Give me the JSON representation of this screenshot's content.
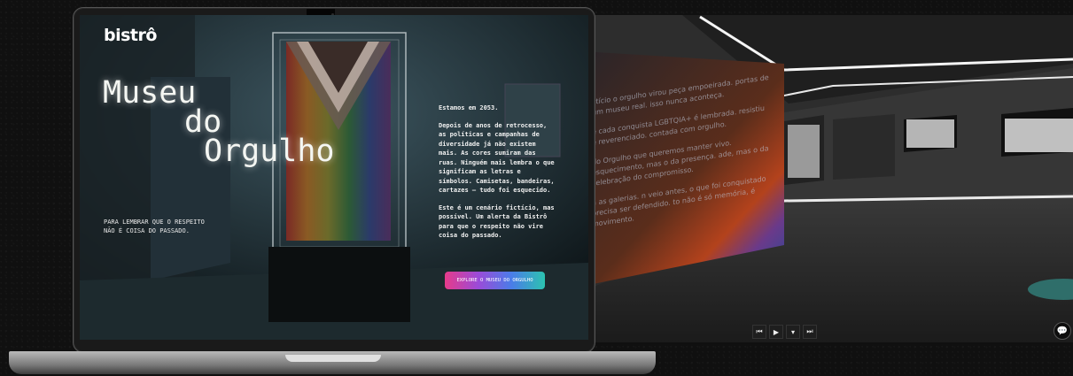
{
  "laptop_site": {
    "brand": "bistrô",
    "title_lines": [
      "Museu",
      "do",
      "Orgulho"
    ],
    "tagline_line1": "PARA LEMBRAR QUE O RESPEITO",
    "tagline_line2": "NÃO É COISA DO PASSADO.",
    "paragraphs": [
      "Estamos em 2053.",
      "Depois de anos de retrocesso, as políticas e campanhas de diversidade já não existem mais. As cores sumiram das ruas. Ninguém mais lembra o que significam as letras e símbolos. Camisetas, bandeiras, cartazes – tudo foi esquecido.",
      "Este é um cenário fictício, mas possível. Um alerta da Bistrô para que o respeito não vire coisa do passado."
    ],
    "cta_label": "EXPLORE O MUSEU DO ORGULHO"
  },
  "gallery": {
    "wall_text": [
      "ctício o orgulho virou peça empoeirada. portas de um museu real. isso nunca aconteça.",
      "e cada conquista LGBTQIA+ é lembrada. resistiu é reverenciado. contada com orgulho.",
      "do Orgulho que queremos manter vivo. esquecimento, mas o da presença. ade, mas o da celebração do compromisso.",
      "a as galerias. n veio antes, o que foi conquistado precisa ser defendido. to não é só memória, é movimento."
    ],
    "controls": [
      "skip-back",
      "play",
      "dropdown",
      "skip-forward"
    ],
    "control_glyphs": [
      "⏮",
      "▶",
      "▾",
      "⏭"
    ],
    "chat_glyph": "💬"
  },
  "colors": {
    "rainbow": [
      "#e63b8a",
      "#9b4bd8",
      "#4a7de8",
      "#2cc3b0"
    ],
    "background": "#101010"
  }
}
